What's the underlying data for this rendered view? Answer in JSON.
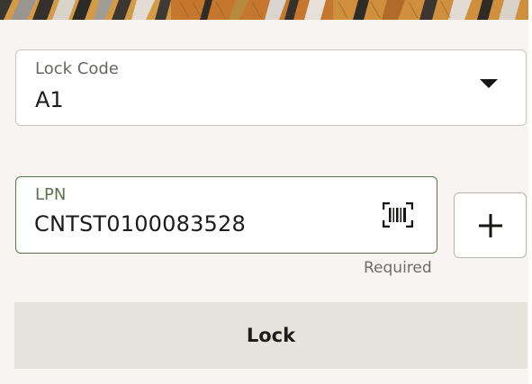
{
  "banner": {
    "icon": "decorative-pattern"
  },
  "lock_code": {
    "label": "Lock Code",
    "value": "A1",
    "icon": "chevron-down-icon"
  },
  "lpn": {
    "label": "LPN",
    "value": "CNTST0100083528",
    "icon": "barcode-scan-icon",
    "hint": "Required",
    "accent_color": "#59744a"
  },
  "add_button": {
    "icon": "plus-icon"
  },
  "lock_button": {
    "label": "Lock"
  }
}
